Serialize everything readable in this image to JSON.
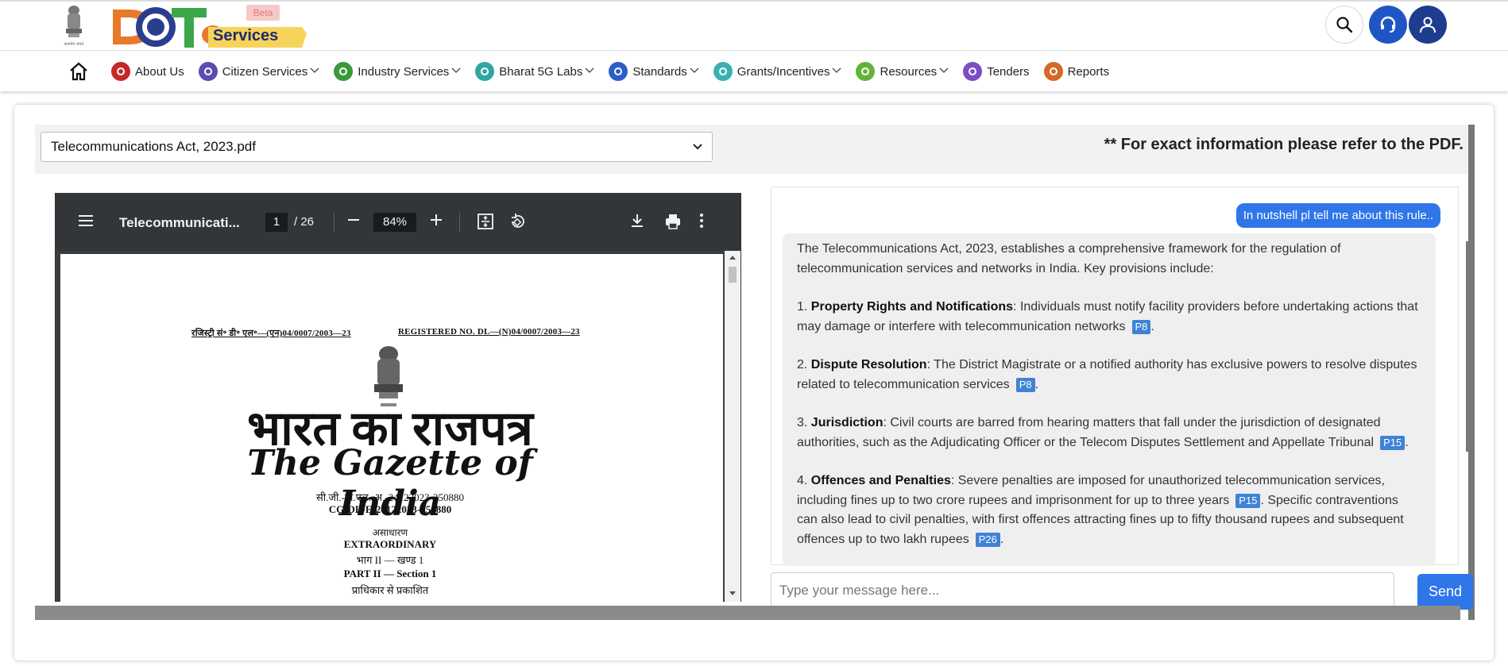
{
  "header": {
    "emblem_caption": "सत्यमेव जयते",
    "logo_text": "Services",
    "logo_badge": "Beta",
    "icons": [
      "search-icon",
      "headset-icon",
      "user-icon"
    ]
  },
  "nav": {
    "items": [
      {
        "label": "About Us",
        "icon": "info-icon",
        "color": "#c62828",
        "dropdown": false
      },
      {
        "label": "Citizen Services",
        "icon": "citizen-icon",
        "color": "#5b4cb0",
        "dropdown": true
      },
      {
        "label": "Industry Services",
        "icon": "industry-icon",
        "color": "#3a9a3a",
        "dropdown": true
      },
      {
        "label": "Bharat 5G Labs",
        "icon": "lab-icon",
        "color": "#2fa6a6",
        "dropdown": true
      },
      {
        "label": "Standards",
        "icon": "standards-icon",
        "color": "#2b5fc7",
        "dropdown": true
      },
      {
        "label": "Grants/Incentives",
        "icon": "grants-icon",
        "color": "#3ab0b0",
        "dropdown": true
      },
      {
        "label": "Resources",
        "icon": "resources-icon",
        "color": "#63b33a",
        "dropdown": true
      },
      {
        "label": "Tenders",
        "icon": "tenders-icon",
        "color": "#7a4fc2",
        "dropdown": false
      },
      {
        "label": "Reports",
        "icon": "reports-icon",
        "color": "#d46a26",
        "dropdown": false
      }
    ]
  },
  "document_select": {
    "value": "Telecommunications Act, 2023.pdf"
  },
  "notice": "** For exact information please refer to the PDF.",
  "pdf_viewer": {
    "title": "Telecommunicati...",
    "page": "1",
    "page_count": "/ 26",
    "zoom": "84%",
    "doc": {
      "reg_left": "रजिस्ट्री सं॰ डी॰ एल॰—(एन)04/0007/2003—23",
      "reg_right": "REGISTERED NO. DL—(N)04/0007/2003—23",
      "hindi_title": "भारत का राजपत्र",
      "english_title": "The Gazette of India",
      "code_hindi": "सी.जी.-डी.एल.-अ.-24122023-250880",
      "code_en": "CG-DL-E-24122023-250880",
      "extra_hindi": "असाधारण",
      "extra_en": "EXTRAORDINARY",
      "part_hindi": "भाग II — खण्ड 1",
      "part_en": "PART II — Section 1",
      "authority_hindi": "प्राधिकार से प्रकाशित"
    }
  },
  "chat": {
    "user_message": "In nutshell pl tell me about this rule..",
    "bot": {
      "intro": "The Telecommunications Act, 2023, establishes a comprehensive framework for the regulation of telecommunication services and networks in India. Key provisions include:",
      "points": [
        {
          "num": "1. ",
          "title": "Property Rights and Notifications",
          "text": ": Individuals must notify facility providers before undertaking actions that may damage or interfere with telecommunication networks",
          "ref": "P8",
          "tail": ".",
          "text2": "",
          "ref2": "",
          "tail2": ""
        },
        {
          "num": "2. ",
          "title": "Dispute Resolution",
          "text": ": The District Magistrate or a notified authority has exclusive powers to resolve disputes related to telecommunication services",
          "ref": "P8",
          "tail": ".",
          "text2": "",
          "ref2": "",
          "tail2": ""
        },
        {
          "num": "3. ",
          "title": "Jurisdiction",
          "text": ": Civil courts are barred from hearing matters that fall under the jurisdiction of designated authorities, such as the Adjudicating Officer or the Telecom Disputes Settlement and Appellate Tribunal",
          "ref": "P15",
          "tail": ".",
          "text2": "",
          "ref2": "",
          "tail2": ""
        },
        {
          "num": "4. ",
          "title": "Offences and Penalties",
          "text": ": Severe penalties are imposed for unauthorized telecommunication services, including fines up to two crore rupees and imprisonment for up to three years",
          "ref": "P15",
          "tail": ".",
          "text2": " Specific contraventions can also lead to civil penalties, with first offences attracting fines up to fifty thousand rupees and subsequent offences up to two lakh rupees",
          "ref2": "P26",
          "tail2": "."
        }
      ]
    },
    "input_placeholder": "Type your message here...",
    "send_label": "Send"
  }
}
